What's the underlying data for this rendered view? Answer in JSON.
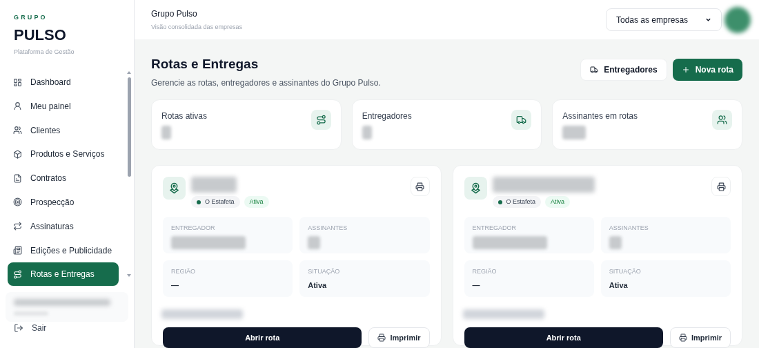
{
  "brand": {
    "eyebrow": "GRUPO",
    "name": "PULSO",
    "subtitle": "Plataforma de Gestão"
  },
  "sidebar": {
    "items": [
      {
        "label": "Dashboard",
        "selected": false
      },
      {
        "label": "Meu painel",
        "selected": false
      },
      {
        "label": "Clientes",
        "selected": false
      },
      {
        "label": "Produtos e Serviços",
        "selected": false
      },
      {
        "label": "Contratos",
        "selected": false
      },
      {
        "label": "Prospecção",
        "selected": false
      },
      {
        "label": "Assinaturas",
        "selected": false
      },
      {
        "label": "Edições e Publicidade",
        "selected": false
      },
      {
        "label": "Rotas e Entregas",
        "selected": true
      }
    ],
    "logout": "Sair"
  },
  "header": {
    "title": "Grupo Pulso",
    "subtitle": "Visão consolidada das empresas",
    "company_select": "Todas as empresas"
  },
  "page": {
    "title": "Rotas e Entregas",
    "subtitle": "Gerencie as rotas, entregadores e assinantes do Grupo Pulso.",
    "buttons": [
      {
        "label": "Entregadores",
        "kind": "secondary"
      },
      {
        "label": "Nova rota",
        "kind": "primary"
      }
    ]
  },
  "stats": [
    {
      "label": "Rotas ativas",
      "kind": "route"
    },
    {
      "label": "Entregadores",
      "kind": "truck"
    },
    {
      "label": "Assinantes em rotas",
      "kind": "users"
    }
  ],
  "routes": [
    {
      "publication": "O Estafeta",
      "status": "Ativa",
      "fields": [
        {
          "label": "ENTREGADOR",
          "kind": "redacted"
        },
        {
          "label": "ASSINANTES",
          "kind": "redacted"
        },
        {
          "label": "REGIÃO",
          "kind": "text",
          "value": "—"
        },
        {
          "label": "SITUAÇÃO",
          "kind": "text",
          "value": "Ativa"
        }
      ],
      "open_button": "Abrir rota",
      "print_button": "Imprimir"
    },
    {
      "publication": "O Estafeta",
      "status": "Ativa",
      "fields": [
        {
          "label": "ENTREGADOR",
          "kind": "redacted"
        },
        {
          "label": "ASSINANTES",
          "kind": "redacted"
        },
        {
          "label": "REGIÃO",
          "kind": "text",
          "value": "—"
        },
        {
          "label": "SITUAÇÃO",
          "kind": "text",
          "value": "Ativa"
        }
      ],
      "open_button": "Abrir rota",
      "print_button": "Imprimir"
    }
  ]
}
